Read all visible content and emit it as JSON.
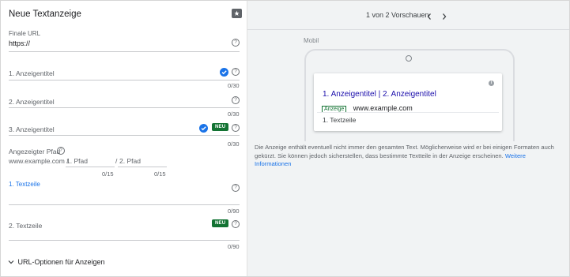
{
  "form": {
    "title": "Neue Textanzeige",
    "final_url": {
      "label": "Finale URL",
      "value": "https://"
    },
    "headline1": {
      "placeholder": "1. Anzeigentitel",
      "counter": "0/30"
    },
    "headline2": {
      "placeholder": "2. Anzeigentitel",
      "counter": "0/30"
    },
    "headline3": {
      "placeholder": "3. Anzeigentitel",
      "badge": "NEU",
      "counter": "0/30"
    },
    "path": {
      "label": "Angezeigter Pfad",
      "domain": "www.example.com /",
      "path1_placeholder": "1. Pfad",
      "separator": "/",
      "path2_placeholder": "2. Pfad",
      "path1_counter": "0/15",
      "path2_counter": "0/15"
    },
    "description1": {
      "label": "1. Textzeile",
      "counter": "0/90"
    },
    "description2": {
      "placeholder": "2. Textzeile",
      "badge": "NEU",
      "counter": "0/90"
    },
    "url_options": {
      "label": "URL-Optionen für Anzeigen"
    }
  },
  "preview": {
    "pager_text": "1 von 2 Vorschauen",
    "prev_icon": "chevron-left-icon",
    "next_icon": "chevron-right-icon",
    "device_label": "Mobil",
    "ad": {
      "headline": "1. Anzeigentitel | 2. Anzeigentitel",
      "badge": "Anzeige",
      "display_url": "www.example.com",
      "description": "1. Textzeile"
    },
    "disclaimer": "Die Anzeige enthält eventuell nicht immer den gesamten Text. Möglicherweise wird er bei einigen Formaten auch gekürzt. Sie können jedoch sicherstellen, dass bestimmte Textteile in der Anzeige erscheinen.",
    "more_link": "Weitere Informationen"
  },
  "colors": {
    "accent": "#1a73e8",
    "badge_green": "#137333",
    "link": "#1a0dab"
  }
}
